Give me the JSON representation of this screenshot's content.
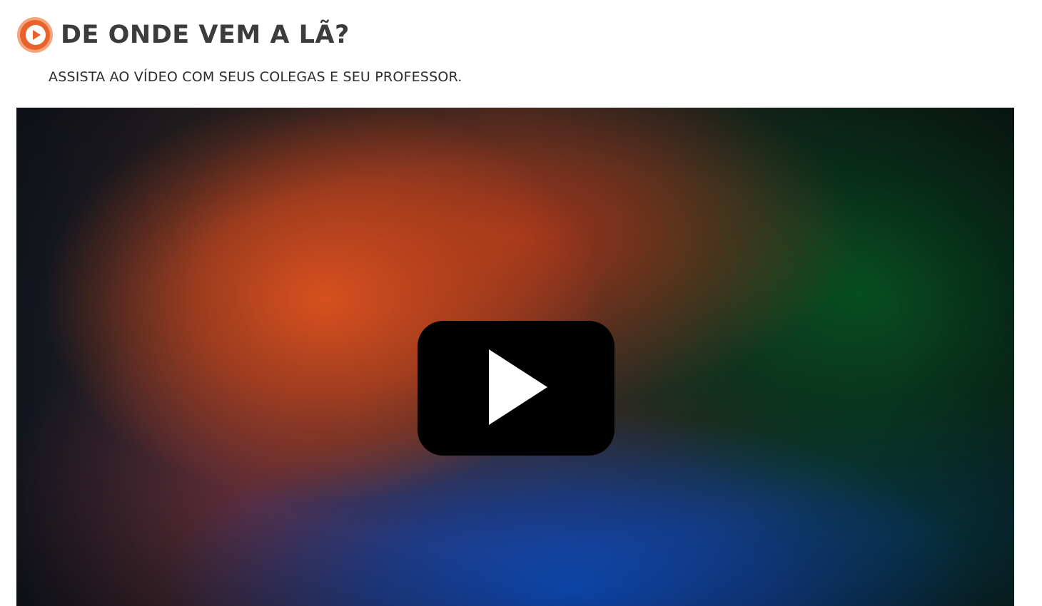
{
  "header": {
    "icon": "play-circle-icon",
    "title": "DE ONDE VEM A LÃ?"
  },
  "instruction": {
    "text": "ASSISTA AO VÍDEO COM SEUS COLEGAS E SEU PROFESSOR."
  },
  "video": {
    "play_icon": "play-icon"
  },
  "colors": {
    "accent_orange": "#e8622c",
    "title_text": "#3c3c3c",
    "play_button_bg": "#000000",
    "play_triangle": "#ffffff"
  }
}
